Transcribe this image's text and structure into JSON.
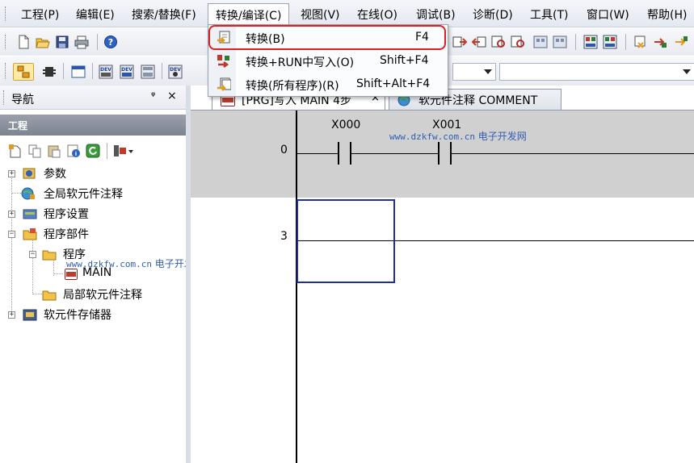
{
  "menubar": {
    "items": [
      {
        "label": "工程(P)"
      },
      {
        "label": "编辑(E)"
      },
      {
        "label": "搜索/替换(F)"
      },
      {
        "label": "转换/编译(C)"
      },
      {
        "label": "视图(V)"
      },
      {
        "label": "在线(O)"
      },
      {
        "label": "调试(B)"
      },
      {
        "label": "诊断(D)"
      },
      {
        "label": "工具(T)"
      },
      {
        "label": "窗口(W)"
      },
      {
        "label": "帮助(H)"
      }
    ]
  },
  "dropdown": {
    "items": [
      {
        "label": "转换(B)",
        "shortcut": "F4",
        "icon": "convert-icon",
        "highlighted": true
      },
      {
        "label": "转换+RUN中写入(O)",
        "shortcut": "Shift+F4",
        "icon": "convert-write-run-icon"
      },
      {
        "label": "转换(所有程序)(R)",
        "shortcut": "Shift+Alt+F4",
        "icon": "convert-all-icon"
      }
    ]
  },
  "navigation": {
    "title": "导航",
    "pin": "ᵠ",
    "close": "×",
    "section_label": "工程",
    "tree": [
      {
        "label": "参数",
        "expander": "+",
        "icon": "parameter-icon"
      },
      {
        "label": "全局软元件注释",
        "icon": "global-comment-icon"
      },
      {
        "label": "程序设置",
        "expander": "+",
        "icon": "program-setting-icon"
      },
      {
        "label": "程序部件",
        "expander": "−",
        "icon": "program-parts-icon"
      },
      {
        "label": "程序",
        "expander": "−",
        "icon": "program-folder-icon"
      },
      {
        "label": "MAIN",
        "icon": "ladder-program-icon"
      },
      {
        "label": "局部软元件注释",
        "icon": "local-comment-icon"
      },
      {
        "label": "软元件存储器",
        "expander": "+",
        "icon": "device-memory-icon"
      }
    ]
  },
  "tabs": [
    {
      "label": "[PRG]写入 MAIN 4步",
      "close": "×",
      "active": true
    },
    {
      "label": "软元件注释 COMMENT",
      "active": false
    }
  ],
  "ladder": {
    "rungs": [
      {
        "step": "0",
        "contacts": [
          "X000",
          "X001"
        ]
      },
      {
        "step": "3"
      }
    ]
  },
  "watermarks": [
    {
      "url": "www.dzkfw.com.cn",
      "text": "电子开发网"
    },
    {
      "url": "www.dzkfw.com.cn",
      "text": "电子开发网"
    }
  ],
  "colors": {
    "highlight_ring": "#e02020",
    "cursor": "#1a2fa8",
    "selected_rung": "#d0d0d0"
  }
}
